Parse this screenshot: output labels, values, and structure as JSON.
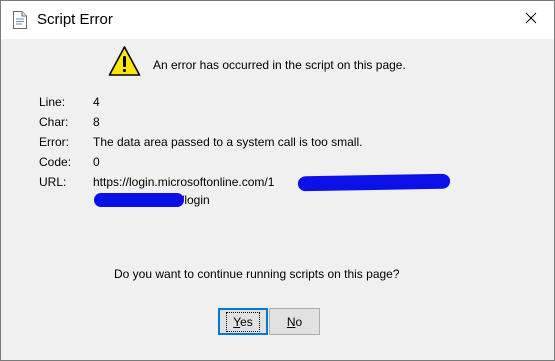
{
  "window": {
    "title": "Script Error",
    "close_glyph": "✕"
  },
  "message": "An error has occurred in the script on this page.",
  "details": {
    "line_label": "Line:",
    "line_value": "4",
    "char_label": "Char:",
    "char_value": "8",
    "error_label": "Error:",
    "error_value": "The data area passed to a system call is too small.",
    "code_label": "Code:",
    "code_value": "0",
    "url_label": "URL:",
    "url_value_line1": "https://login.microsoftonline.com/1",
    "url_value_line2": "/login"
  },
  "question": "Do you want to continue running scripts on this page?",
  "buttons": {
    "yes_mnemonic": "Y",
    "yes_rest": "es",
    "no_mnemonic": "N",
    "no_rest": "o"
  },
  "colors": {
    "redaction": "#0a10e6",
    "default_button_border": "#0078d7",
    "warning_fill": "#ffe600"
  },
  "icons": {
    "title": "document-script-icon",
    "close": "close-icon",
    "warning": "warning-icon"
  }
}
